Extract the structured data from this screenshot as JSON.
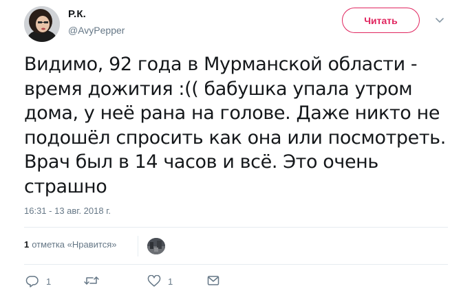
{
  "user": {
    "display_name": "Р.К.",
    "handle": "@AvyPepper",
    "avatar_icon": "user-avatar"
  },
  "follow_button": {
    "label": "Читать",
    "color": "#e0245e"
  },
  "tweet": {
    "text": "Видимо, 92 года в Мурманской области -\nвремя дожития :(( бабушка упала утром\nдома, у неё рана на голове. Даже никто не\nподошёл спросить как она или посмотреть.\nВрач был в 14 часов и всё. Это очень\nстрашно",
    "timestamp": "16:31 - 13 авг. 2018 г."
  },
  "likes": {
    "count": "1",
    "label": "отметка «Нравится»"
  },
  "actions": {
    "reply_count": "1",
    "retweet_count": "",
    "like_count": "1"
  },
  "colors": {
    "text_primary": "#14171a",
    "text_secondary": "#657786",
    "divider": "#e6ecf0",
    "accent": "#e0245e"
  }
}
